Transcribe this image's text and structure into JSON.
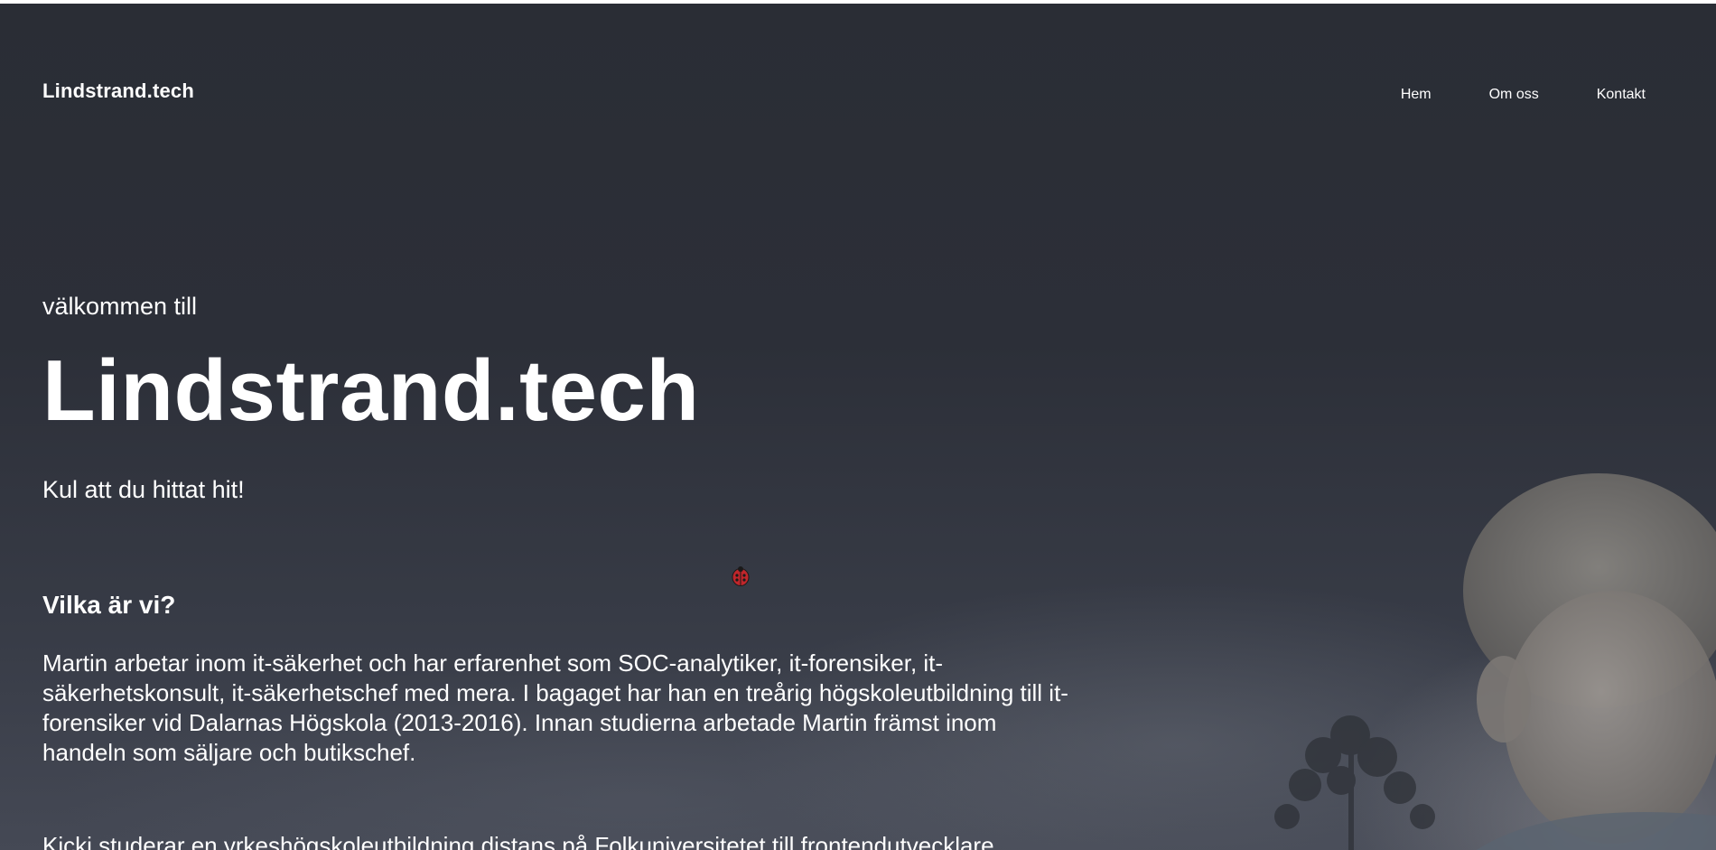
{
  "site": {
    "logo_text": "Lindstrand.tech"
  },
  "nav": {
    "items": [
      {
        "label": "Hem"
      },
      {
        "label": "Om oss"
      },
      {
        "label": "Kontakt"
      }
    ]
  },
  "hero": {
    "welcome": "välkommen till",
    "title": "Lindstrand.tech",
    "tagline": "Kul att du hittat hit!"
  },
  "about": {
    "heading": "Vilka är vi?",
    "paragraphs": [
      "Martin arbetar inom it-säkerhet och har erfarenhet som SOC-analytiker, it-forensiker, it-säkerhetskonsult, it-säkerhetschef med mera. I bagaget har han en treårig högskoleutbildning till it-forensiker vid Dalarnas Högskola (2013-2016). Innan studierna arbetade Martin främst inom handeln som säljare och butikschef.",
      "Kicki studerar en yrkeshögskoleutbildning distans på Folkuniversitetet till frontendutvecklare"
    ]
  },
  "icons": {
    "cursor": "ladybug-cursor-icon",
    "background": "background-photo"
  },
  "colors": {
    "background_dark": "#2a2d35",
    "text": "#ffffff",
    "ladybug_red": "#c0262b"
  }
}
